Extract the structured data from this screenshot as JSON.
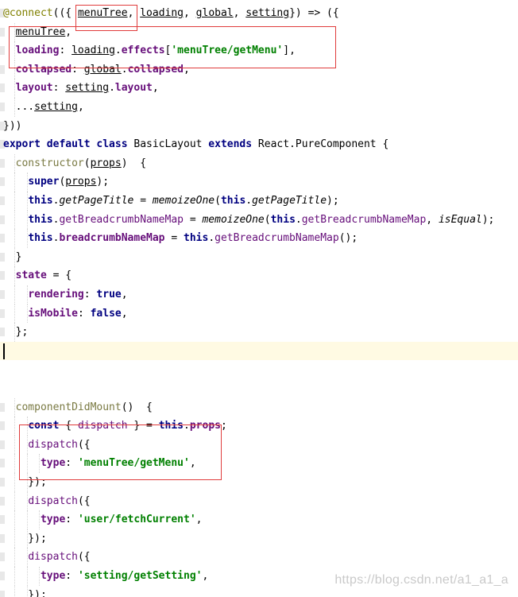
{
  "editor": {
    "lines": [
      [
        {
          "t": "@connect",
          "c": "anno"
        },
        {
          "t": "(({ "
        },
        {
          "t": "menuTree",
          "c": "param"
        },
        {
          "t": ", "
        },
        {
          "t": "loading",
          "c": "param"
        },
        {
          "t": ", "
        },
        {
          "t": "global",
          "c": "param"
        },
        {
          "t": ", "
        },
        {
          "t": "setting",
          "c": "param"
        },
        {
          "t": "}) => ({"
        }
      ],
      [
        {
          "t": "  "
        },
        {
          "t": "menuTree",
          "c": "param"
        },
        {
          "t": ","
        }
      ],
      [
        {
          "t": "  "
        },
        {
          "t": "loading",
          "c": "prop"
        },
        {
          "t": ": "
        },
        {
          "t": "loading",
          "c": "param"
        },
        {
          "t": "."
        },
        {
          "t": "effects",
          "c": "prop"
        },
        {
          "t": "["
        },
        {
          "t": "'menuTree/getMenu'",
          "c": "str"
        },
        {
          "t": "],"
        }
      ],
      [
        {
          "t": "  "
        },
        {
          "t": "collapsed",
          "c": "prop"
        },
        {
          "t": ": "
        },
        {
          "t": "global",
          "c": "param"
        },
        {
          "t": "."
        },
        {
          "t": "collapsed",
          "c": "prop"
        },
        {
          "t": ","
        }
      ],
      [
        {
          "t": "  "
        },
        {
          "t": "layout",
          "c": "prop"
        },
        {
          "t": ": "
        },
        {
          "t": "setting",
          "c": "param"
        },
        {
          "t": "."
        },
        {
          "t": "layout",
          "c": "prop"
        },
        {
          "t": ","
        }
      ],
      [
        {
          "t": "  ..."
        },
        {
          "t": "setting",
          "c": "param"
        },
        {
          "t": ","
        }
      ],
      [
        {
          "t": "}))"
        }
      ],
      [
        {
          "t": "export default ",
          "c": "kw"
        },
        {
          "t": "class ",
          "c": "kw"
        },
        {
          "t": "BasicLayout "
        },
        {
          "t": "extends ",
          "c": "kw"
        },
        {
          "t": "React.PureComponent {"
        }
      ],
      [
        {
          "t": "  "
        },
        {
          "t": "constructor",
          "c": "mth"
        },
        {
          "t": "("
        },
        {
          "t": "props",
          "c": "param"
        },
        {
          "t": ")  {"
        }
      ],
      [
        {
          "t": "    "
        },
        {
          "t": "super",
          "c": "kw"
        },
        {
          "t": "("
        },
        {
          "t": "props",
          "c": "param"
        },
        {
          "t": ");"
        }
      ],
      [
        {
          "t": "    "
        },
        {
          "t": "this",
          "c": "kw"
        },
        {
          "t": "."
        },
        {
          "t": "getPageTitle",
          "c": "it"
        },
        {
          "t": " = "
        },
        {
          "t": "memoizeOne",
          "c": "it"
        },
        {
          "t": "("
        },
        {
          "t": "this",
          "c": "kw"
        },
        {
          "t": "."
        },
        {
          "t": "getPageTitle",
          "c": "it"
        },
        {
          "t": ");"
        }
      ],
      [
        {
          "t": "    "
        },
        {
          "t": "this",
          "c": "kw"
        },
        {
          "t": "."
        },
        {
          "t": "getBreadcrumbNameMap",
          "c": "pc"
        },
        {
          "t": " = "
        },
        {
          "t": "memoizeOne",
          "c": "it"
        },
        {
          "t": "("
        },
        {
          "t": "this",
          "c": "kw"
        },
        {
          "t": "."
        },
        {
          "t": "getBreadcrumbNameMap",
          "c": "pc"
        },
        {
          "t": ", "
        },
        {
          "t": "isEqual",
          "c": "it"
        },
        {
          "t": ");"
        }
      ],
      [
        {
          "t": "    "
        },
        {
          "t": "this",
          "c": "kw"
        },
        {
          "t": "."
        },
        {
          "t": "breadcrumbNameMap",
          "c": "prop"
        },
        {
          "t": " = "
        },
        {
          "t": "this",
          "c": "kw"
        },
        {
          "t": "."
        },
        {
          "t": "getBreadcrumbNameMap",
          "c": "pc"
        },
        {
          "t": "();"
        }
      ],
      [
        {
          "t": "  }"
        }
      ],
      [
        {
          "t": "  "
        },
        {
          "t": "state",
          "c": "prop"
        },
        {
          "t": " = {"
        }
      ],
      [
        {
          "t": "    "
        },
        {
          "t": "rendering",
          "c": "prop"
        },
        {
          "t": ": "
        },
        {
          "t": "true",
          "c": "kw"
        },
        {
          "t": ","
        }
      ],
      [
        {
          "t": "    "
        },
        {
          "t": "isMobile",
          "c": "prop"
        },
        {
          "t": ": "
        },
        {
          "t": "false",
          "c": "kw"
        },
        {
          "t": ","
        }
      ],
      [
        {
          "t": "  };"
        }
      ],
      [
        {
          "t": ""
        }
      ],
      [
        {
          "t": ""
        }
      ],
      [
        {
          "t": ""
        }
      ],
      [
        {
          "t": "  "
        },
        {
          "t": "componentDidMount",
          "c": "mth"
        },
        {
          "t": "()  {"
        }
      ],
      [
        {
          "t": "    "
        },
        {
          "t": "const",
          "c": "kw"
        },
        {
          "t": " { "
        },
        {
          "t": "dispatch",
          "c": "pc"
        },
        {
          "t": " } = "
        },
        {
          "t": "this",
          "c": "kw"
        },
        {
          "t": "."
        },
        {
          "t": "props",
          "c": "prop"
        },
        {
          "t": ";"
        }
      ],
      [
        {
          "t": "    "
        },
        {
          "t": "dispatch",
          "c": "pc"
        },
        {
          "t": "({"
        }
      ],
      [
        {
          "t": "      "
        },
        {
          "t": "type",
          "c": "prop"
        },
        {
          "t": ": "
        },
        {
          "t": "'menuTree/getMenu'",
          "c": "str"
        },
        {
          "t": ","
        }
      ],
      [
        {
          "t": "    });"
        }
      ],
      [
        {
          "t": "    "
        },
        {
          "t": "dispatch",
          "c": "pc"
        },
        {
          "t": "({"
        }
      ],
      [
        {
          "t": "      "
        },
        {
          "t": "type",
          "c": "prop"
        },
        {
          "t": ": "
        },
        {
          "t": "'user/fetchCurrent'",
          "c": "str"
        },
        {
          "t": ","
        }
      ],
      [
        {
          "t": "    });"
        }
      ],
      [
        {
          "t": "    "
        },
        {
          "t": "dispatch",
          "c": "pc"
        },
        {
          "t": "({"
        }
      ],
      [
        {
          "t": "      "
        },
        {
          "t": "type",
          "c": "prop"
        },
        {
          "t": ": "
        },
        {
          "t": "'setting/getSetting'",
          "c": "str"
        },
        {
          "t": ","
        }
      ],
      [
        {
          "t": "    });"
        }
      ]
    ],
    "current_line": 18
  },
  "watermark": "https://blog.csdn.net/a1_a1_a"
}
